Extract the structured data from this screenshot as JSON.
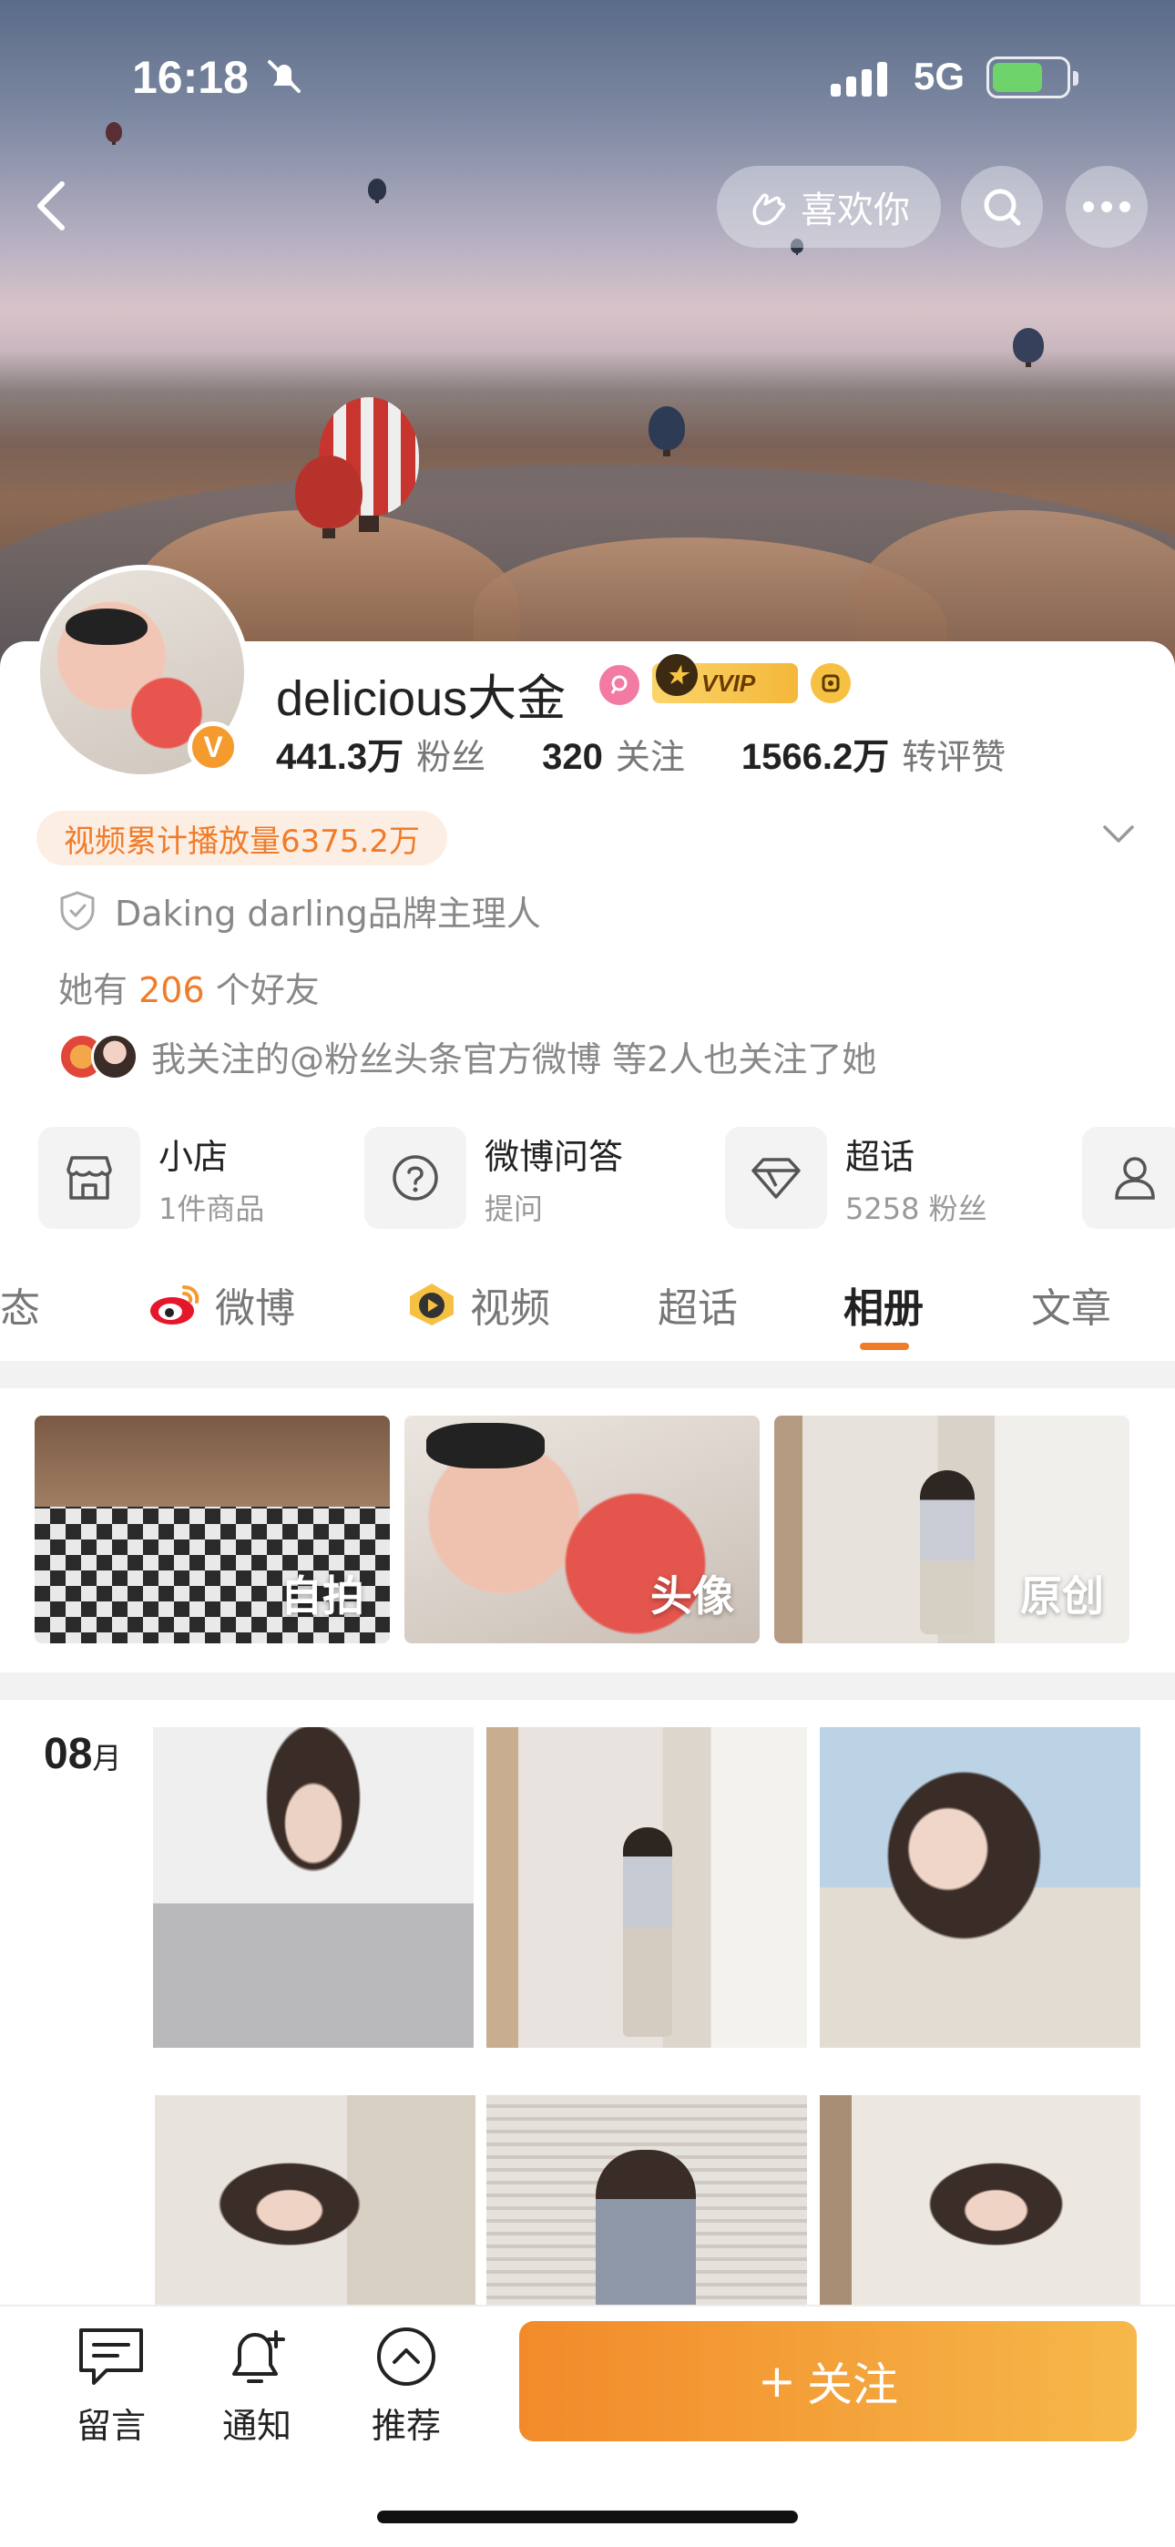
{
  "status_bar": {
    "time": "16:18",
    "network": "5G"
  },
  "nav": {
    "like_label": "喜欢你"
  },
  "profile": {
    "username": "delicious大金",
    "vvip_label": "VVIP",
    "verified_mark": "V",
    "stats": [
      {
        "value": "441.3万",
        "label": "粉丝"
      },
      {
        "value": "320",
        "label": "关注"
      },
      {
        "value": "1566.2万",
        "label": "转评赞"
      }
    ],
    "video_pill": "视频累计播放量6375.2万",
    "verification": "Daking darling品牌主理人",
    "friends_prefix": "她有",
    "friends_count": "206",
    "friends_suffix": "个好友",
    "mutual_text": "我关注的@粉丝头条官方微博 等2人也关注了她"
  },
  "services": [
    {
      "title": "小店",
      "subtitle": "1件商品",
      "icon": "shop-icon"
    },
    {
      "title": "微博问答",
      "subtitle": "提问",
      "icon": "question-icon"
    },
    {
      "title": "超话",
      "subtitle": "5258 粉丝",
      "icon": "diamond-icon"
    }
  ],
  "tabs": [
    "态",
    "微博",
    "视频",
    "超话",
    "相册",
    "文章"
  ],
  "active_tab": "相册",
  "albums": [
    {
      "label": "自拍"
    },
    {
      "label": "头像"
    },
    {
      "label": "原创"
    }
  ],
  "month": {
    "number": "08",
    "unit": "月"
  },
  "bottom_bar": {
    "comment": "留言",
    "notify": "通知",
    "recommend": "推荐",
    "follow": "关注",
    "follow_plus": "+"
  },
  "colors": {
    "accent": "#f07c2a",
    "follow_start": "#f28a2a",
    "follow_end": "#f6b84a"
  }
}
